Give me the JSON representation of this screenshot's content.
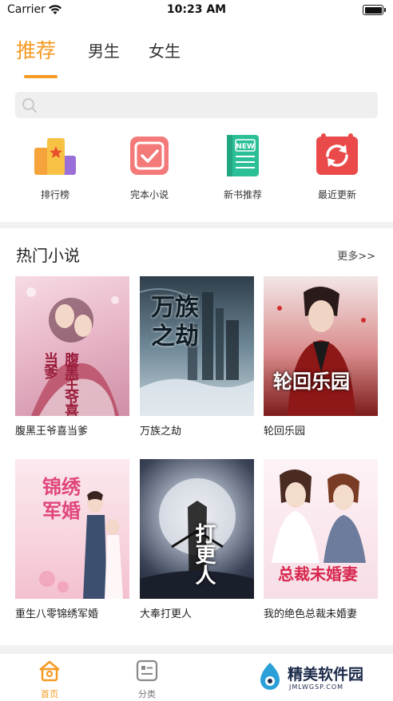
{
  "status_bar": {
    "carrier": "Carrier",
    "time": "10:23 AM"
  },
  "tabs": [
    {
      "label": "推荐",
      "active": true
    },
    {
      "label": "男生",
      "active": false
    },
    {
      "label": "女生",
      "active": false
    }
  ],
  "search": {
    "placeholder": ""
  },
  "quick_menu": [
    {
      "label": "排行榜",
      "icon": "ranking-icon"
    },
    {
      "label": "完本小说",
      "icon": "finished-check-icon"
    },
    {
      "label": "新书推荐",
      "icon": "new-book-icon"
    },
    {
      "label": "最近更新",
      "icon": "refresh-icon"
    }
  ],
  "hot": {
    "title": "热门小说",
    "more": "更多>>",
    "books": [
      {
        "title": "腹黑王爷喜当爹",
        "cover_text": "腹黑王爷喜当爹"
      },
      {
        "title": "万族之劫",
        "cover_text": "万族之劫"
      },
      {
        "title": "轮回乐园",
        "cover_text": "轮回乐园"
      },
      {
        "title": "重生八零锦绣军婚",
        "cover_text": "锦绣军婚"
      },
      {
        "title": "大奉打更人",
        "cover_text": "打更人"
      },
      {
        "title": "我的绝色总裁未婚妻",
        "cover_text": "总裁未婚妻"
      }
    ]
  },
  "bottom_nav": [
    {
      "label": "首页",
      "icon": "home-icon",
      "active": true
    },
    {
      "label": "分类",
      "icon": "category-icon",
      "active": false
    }
  ],
  "watermark": {
    "title": "精美软件园",
    "subtitle": "JMLWGSP.COM"
  },
  "colors": {
    "accent": "#f59a23",
    "divider": "#f1f1f1"
  }
}
